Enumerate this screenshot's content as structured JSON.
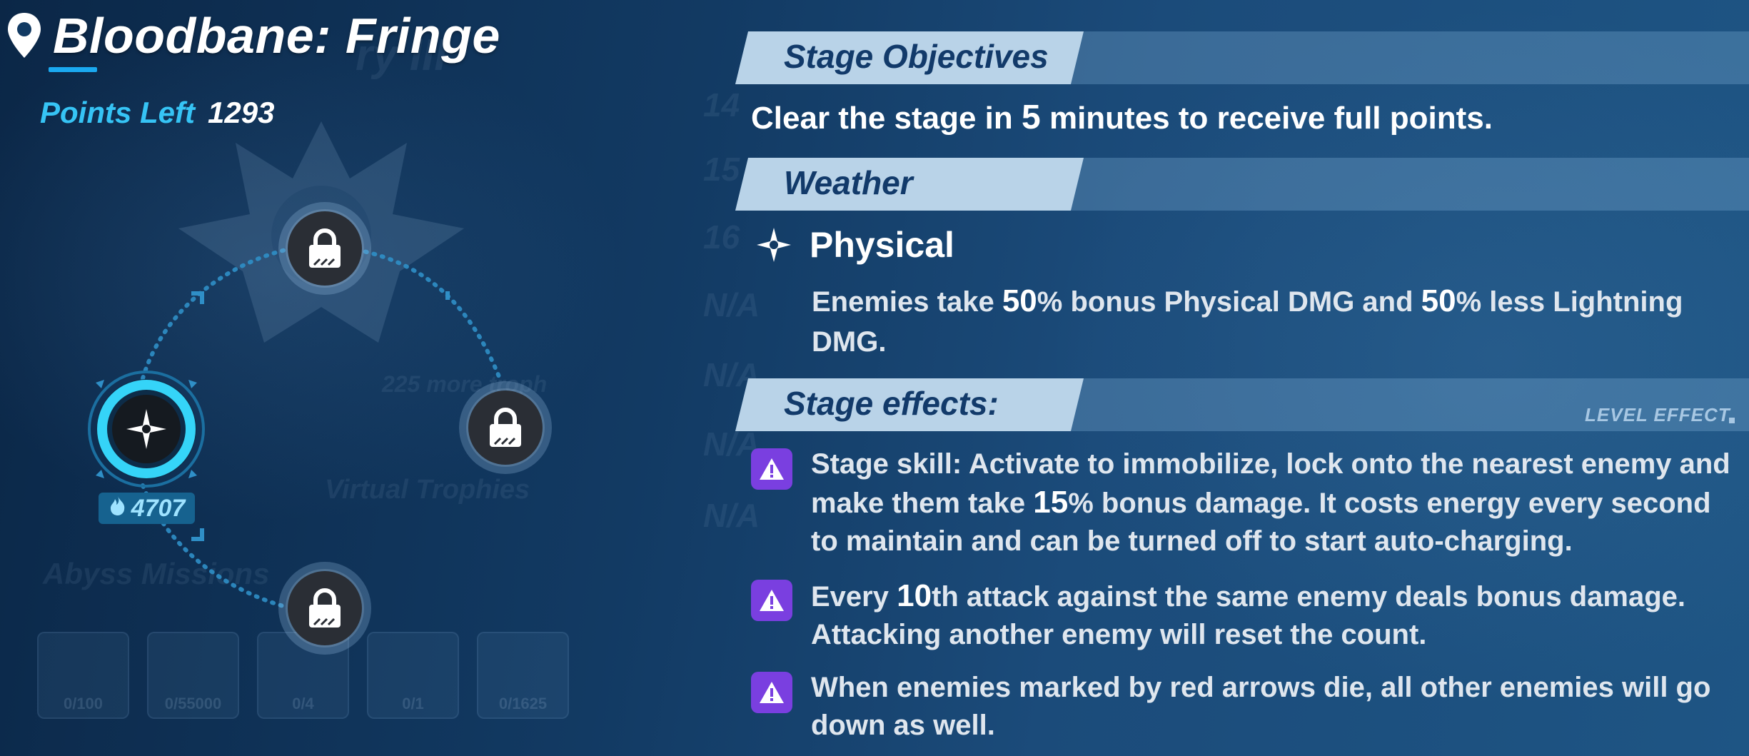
{
  "title": "Bloodbane: Fringe",
  "points": {
    "label": "Points Left",
    "value": "1293"
  },
  "map": {
    "active_score": "4707"
  },
  "objectives": {
    "header": "Stage Objectives",
    "text_before": "Clear the stage in ",
    "minutes": "5",
    "text_after": " minutes to receive full points."
  },
  "weather": {
    "header": "Weather",
    "name": "Physical",
    "desc_1": "Enemies take ",
    "num_1": "50",
    "desc_2": "% bonus Physical DMG and ",
    "num_2": "50",
    "desc_3": "% less Lightning DMG."
  },
  "effects": {
    "header": "Stage effects:",
    "level_effect_label": "LEVEL EFFECT",
    "items": [
      {
        "a": "Stage skill: Activate to immobilize, lock onto the nearest enemy and make them take ",
        "n": "15",
        "b": "% bonus damage. It costs energy every second to maintain and can be turned off to start auto-charging."
      },
      {
        "a": "Every ",
        "n": "10",
        "b": "th attack against the same enemy deals bonus damage. Attacking another enemy will reset the count."
      },
      {
        "a": "When enemies marked by red arrows die, all other enemies will go down as well.",
        "n": "",
        "b": ""
      }
    ]
  },
  "background_faded": {
    "rank_text": "ry III",
    "stars_text": "225 more troph",
    "virtual_trophies": "Virtual Trophies",
    "abyss_missions": "Abyss Missions",
    "tiles": [
      "0/100",
      "0/55000",
      "0/4",
      "0/1",
      "0/1625"
    ],
    "rows": [
      "14",
      "15",
      "16",
      "N/A",
      "N/A",
      "N/A",
      "N/A"
    ]
  },
  "colors": {
    "accent": "#36c4f5",
    "header_bar": "#b9d3e8",
    "header_text": "#123a6a",
    "warn": "#7a3fe0"
  }
}
